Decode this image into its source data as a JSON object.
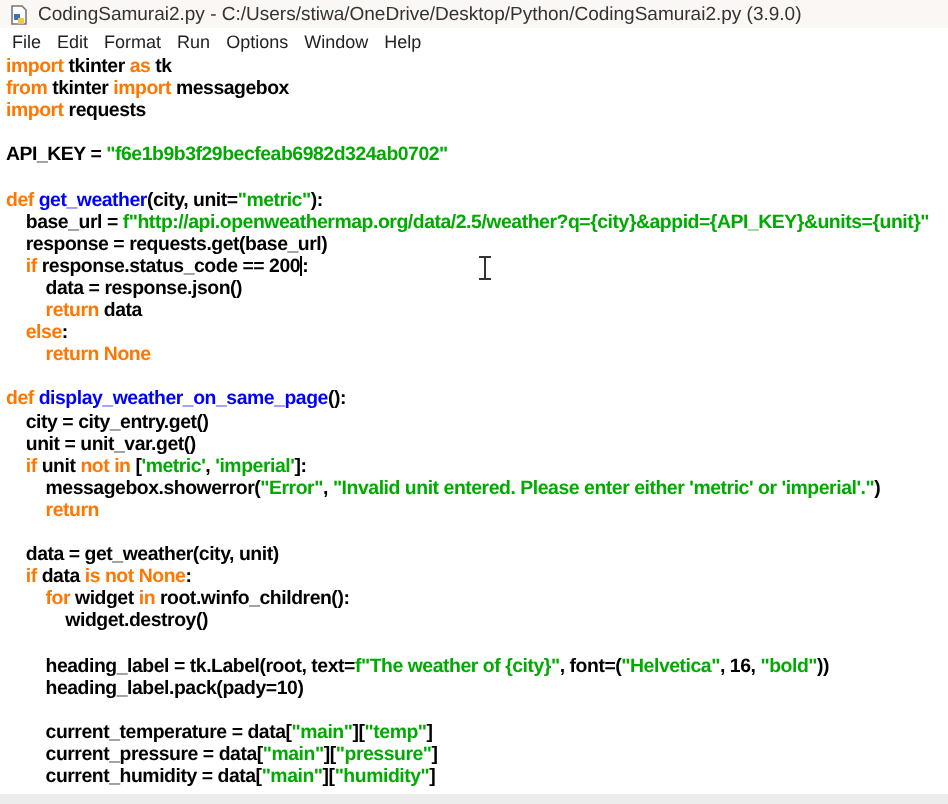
{
  "window": {
    "title": "CodingSamurai2.py - C:/Users/stiwa/OneDrive/Desktop/Python/CodingSamurai2.py (3.9.0)"
  },
  "menu": [
    "File",
    "Edit",
    "Format",
    "Run",
    "Options",
    "Window",
    "Help"
  ],
  "code_lines": [
    {
      "kind": "code",
      "tokens": [
        {
          "kind": "kw",
          "text": "import"
        },
        {
          "kind": "code",
          "text": " tkinter "
        },
        {
          "kind": "kw",
          "text": "as"
        },
        {
          "kind": "code",
          "text": " tk"
        }
      ]
    },
    {
      "kind": "code",
      "tokens": [
        {
          "kind": "kw",
          "text": "from"
        },
        {
          "kind": "code",
          "text": " tkinter "
        },
        {
          "kind": "kw",
          "text": "import"
        },
        {
          "kind": "code",
          "text": " messagebox"
        }
      ]
    },
    {
      "kind": "code",
      "tokens": [
        {
          "kind": "kw",
          "text": "import"
        },
        {
          "kind": "code",
          "text": " requests"
        }
      ]
    },
    {
      "kind": "blank"
    },
    {
      "kind": "code",
      "tokens": [
        {
          "kind": "code",
          "text": "API_KEY = "
        },
        {
          "kind": "str",
          "text": "\"f6e1b9b3f29becfeab6982d324ab0702\""
        }
      ]
    },
    {
      "kind": "blank"
    },
    {
      "kind": "code",
      "tokens": [
        {
          "kind": "kw",
          "text": "def "
        },
        {
          "kind": "def",
          "text": "get_weather"
        },
        {
          "kind": "code",
          "text": "(city, unit="
        },
        {
          "kind": "str",
          "text": "\"metric\""
        },
        {
          "kind": "code",
          "text": "):"
        }
      ]
    },
    {
      "kind": "code",
      "tokens": [
        {
          "kind": "code",
          "text": "    base_url = "
        },
        {
          "kind": "str",
          "text": "f\"http://api.openweathermap.org/data/2.5/weather?q={city}&appid={API_KEY}&units={unit}\""
        }
      ]
    },
    {
      "kind": "code",
      "tokens": [
        {
          "kind": "code",
          "text": "    response = requests.get(base_url)"
        }
      ]
    },
    {
      "kind": "code",
      "tokens": [
        {
          "kind": "kw",
          "text": "    if"
        },
        {
          "kind": "code",
          "text": " response.status_code == 200"
        },
        {
          "kind": "caret"
        },
        {
          "kind": "code",
          "text": ":"
        }
      ]
    },
    {
      "kind": "code",
      "tokens": [
        {
          "kind": "code",
          "text": "        data = response.json()"
        }
      ]
    },
    {
      "kind": "code",
      "tokens": [
        {
          "kind": "kw",
          "text": "        return"
        },
        {
          "kind": "code",
          "text": " data"
        }
      ]
    },
    {
      "kind": "code",
      "tokens": [
        {
          "kind": "kw",
          "text": "    else"
        },
        {
          "kind": "code",
          "text": ":"
        }
      ]
    },
    {
      "kind": "code",
      "tokens": [
        {
          "kind": "kw",
          "text": "        return None"
        }
      ]
    },
    {
      "kind": "blank"
    },
    {
      "kind": "code",
      "tokens": [
        {
          "kind": "kw",
          "text": "def "
        },
        {
          "kind": "def",
          "text": "display_weather_on_same_page"
        },
        {
          "kind": "code",
          "text": "():"
        }
      ]
    },
    {
      "kind": "code",
      "tokens": [
        {
          "kind": "code",
          "text": "    city = city_entry.get()"
        }
      ]
    },
    {
      "kind": "code",
      "tokens": [
        {
          "kind": "code",
          "text": "    unit = unit_var.get()"
        }
      ]
    },
    {
      "kind": "code",
      "tokens": [
        {
          "kind": "kw",
          "text": "    if"
        },
        {
          "kind": "code",
          "text": " unit "
        },
        {
          "kind": "kw",
          "text": "not in"
        },
        {
          "kind": "code",
          "text": " ["
        },
        {
          "kind": "str",
          "text": "'metric'"
        },
        {
          "kind": "code",
          "text": ", "
        },
        {
          "kind": "str",
          "text": "'imperial'"
        },
        {
          "kind": "code",
          "text": "]:"
        }
      ]
    },
    {
      "kind": "code",
      "tokens": [
        {
          "kind": "code",
          "text": "        messagebox.showerror("
        },
        {
          "kind": "str",
          "text": "\"Error\""
        },
        {
          "kind": "code",
          "text": ", "
        },
        {
          "kind": "str",
          "text": "\"Invalid unit entered. Please enter either 'metric' or 'imperial'.\""
        },
        {
          "kind": "code",
          "text": ")"
        }
      ]
    },
    {
      "kind": "code",
      "tokens": [
        {
          "kind": "kw",
          "text": "        return"
        }
      ]
    },
    {
      "kind": "blank"
    },
    {
      "kind": "code",
      "tokens": [
        {
          "kind": "code",
          "text": "    data = get_weather(city, unit)"
        }
      ]
    },
    {
      "kind": "code",
      "tokens": [
        {
          "kind": "kw",
          "text": "    if"
        },
        {
          "kind": "code",
          "text": " data "
        },
        {
          "kind": "kw",
          "text": "is not None"
        },
        {
          "kind": "code",
          "text": ":"
        }
      ]
    },
    {
      "kind": "code",
      "tokens": [
        {
          "kind": "kw",
          "text": "        for"
        },
        {
          "kind": "code",
          "text": " widget "
        },
        {
          "kind": "kw",
          "text": "in"
        },
        {
          "kind": "code",
          "text": " root.winfo_children():"
        }
      ]
    },
    {
      "kind": "code",
      "tokens": [
        {
          "kind": "code",
          "text": "            widget.destroy()"
        }
      ]
    },
    {
      "kind": "blank"
    },
    {
      "kind": "code",
      "tokens": [
        {
          "kind": "code",
          "text": "        heading_label = tk.Label(root, text="
        },
        {
          "kind": "str",
          "text": "f\"The weather of {city}\""
        },
        {
          "kind": "code",
          "text": ", font=("
        },
        {
          "kind": "str",
          "text": "\"Helvetica\""
        },
        {
          "kind": "code",
          "text": ", 16, "
        },
        {
          "kind": "str",
          "text": "\"bold\""
        },
        {
          "kind": "code",
          "text": "))"
        }
      ]
    },
    {
      "kind": "code",
      "tokens": [
        {
          "kind": "code",
          "text": "        heading_label.pack(pady=10)"
        }
      ]
    },
    {
      "kind": "blank"
    },
    {
      "kind": "code",
      "tokens": [
        {
          "kind": "code",
          "text": "        current_temperature = data["
        },
        {
          "kind": "str",
          "text": "\"main\""
        },
        {
          "kind": "code",
          "text": "]["
        },
        {
          "kind": "str",
          "text": "\"temp\""
        },
        {
          "kind": "code",
          "text": "]"
        }
      ]
    },
    {
      "kind": "code",
      "tokens": [
        {
          "kind": "code",
          "text": "        current_pressure = data["
        },
        {
          "kind": "str",
          "text": "\"main\""
        },
        {
          "kind": "code",
          "text": "]["
        },
        {
          "kind": "str",
          "text": "\"pressure\""
        },
        {
          "kind": "code",
          "text": "]"
        }
      ]
    },
    {
      "kind": "code",
      "tokens": [
        {
          "kind": "code",
          "text": "        current_humidity = data["
        },
        {
          "kind": "str",
          "text": "\"main\""
        },
        {
          "kind": "code",
          "text": "]["
        },
        {
          "kind": "str",
          "text": "\"humidity\""
        },
        {
          "kind": "code",
          "text": "]"
        }
      ]
    }
  ]
}
